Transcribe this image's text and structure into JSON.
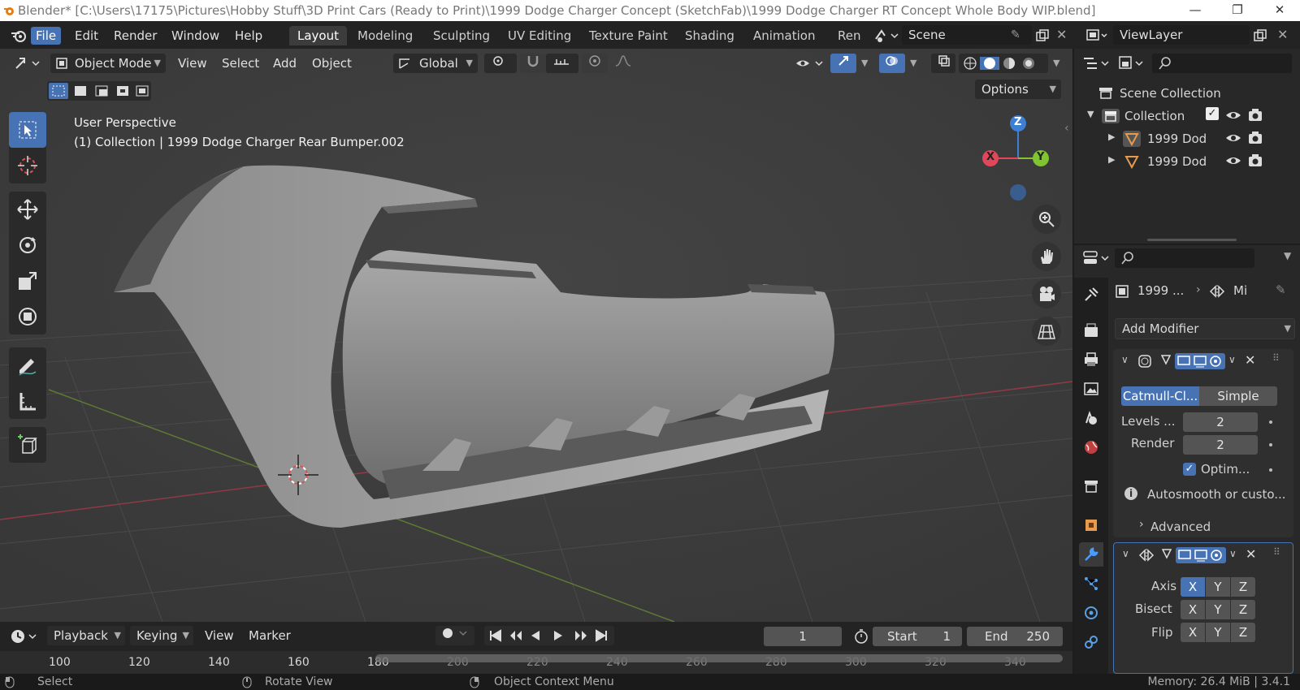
{
  "window": {
    "title": "Blender* [C:\\Users\\17175\\Pictures\\Hobby Stuff\\3D Print Cars (Ready to Print)\\1999 Dodge Charger Concept (SketchFab)\\1999 Dodge Charger RT Concept Whole Body WIP.blend]",
    "minimize": "—",
    "maximize": "❐",
    "close": "✕"
  },
  "menubar": {
    "items": [
      "File",
      "Edit",
      "Render",
      "Window",
      "Help"
    ],
    "workspaces": [
      "Layout",
      "Modeling",
      "Sculpting",
      "UV Editing",
      "Texture Paint",
      "Shading",
      "Animation",
      "Ren"
    ],
    "scene": "Scene",
    "view_layer": "ViewLayer"
  },
  "viewport": {
    "mode": "Object Mode",
    "menus": [
      "View",
      "Select",
      "Add",
      "Object"
    ],
    "orientation": "Global",
    "options": "Options",
    "perspective_label": "User Perspective",
    "object_label": "(1) Collection | 1999 Dodge Charger Rear Bumper.002",
    "gizmo": {
      "x": "X",
      "y": "Y",
      "z": "Z"
    }
  },
  "timeline": {
    "menus": [
      "Playback",
      "Keying",
      "View",
      "Marker"
    ],
    "current_frame": "1",
    "start_label": "Start",
    "start": "1",
    "end_label": "End",
    "end": "250",
    "ruler": [
      "100",
      "120",
      "140",
      "160",
      "180",
      "200",
      "220",
      "240",
      "260",
      "280",
      "300",
      "320",
      "340"
    ]
  },
  "outliner": {
    "root": "Scene Collection",
    "collection": "Collection",
    "objects": [
      "1999 Dod",
      "1999 Dod"
    ]
  },
  "properties": {
    "breadcrumb_object": "1999 ...",
    "breadcrumb_modifier": "Mi",
    "add_modifier": "Add Modifier",
    "subsurf": {
      "tab_catmull": "Catmull-Cl...",
      "tab_simple": "Simple",
      "levels_label": "Levels ...",
      "levels_value": "2",
      "render_label": "Render",
      "render_value": "2",
      "optimal_label": "Optim...",
      "info": "Autosmooth or custo...",
      "advanced": "Advanced"
    },
    "mirror": {
      "axis_label": "Axis",
      "bisect_label": "Bisect",
      "flip_label": "Flip",
      "x": "X",
      "y": "Y",
      "z": "Z"
    }
  },
  "status": {
    "select": "Select",
    "rotate": "Rotate View",
    "context": "Object Context Menu",
    "memory": "Memory: 26.4 MiB | 3.4.1"
  },
  "colors": {
    "accent": "#4772b3",
    "axis_x": "#e0475a",
    "axis_y": "#80c531",
    "axis_z": "#3c7fd3"
  }
}
